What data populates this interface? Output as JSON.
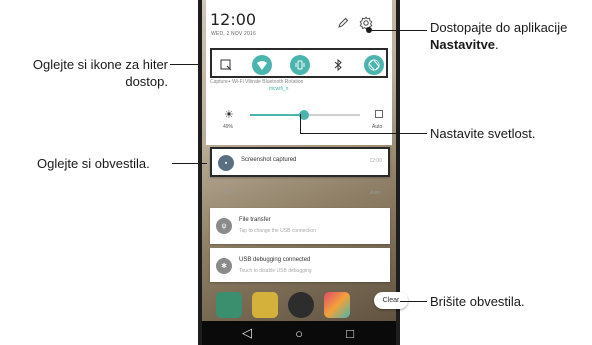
{
  "status": {
    "time": "12:00",
    "date": "WED, 2 NOV 2016"
  },
  "quick_settings": {
    "labels": "Capture+    Wi-Fi      Vibrate   Bluetooth   Rotation",
    "wifi_ssid": "mcwifi_n"
  },
  "brightness": {
    "level_percent": 49,
    "percent_label": "49%",
    "auto_label": "Auto"
  },
  "notifications": [
    {
      "title": "Screenshot captured",
      "subtitle": "",
      "time": "12:00"
    },
    {
      "title": "File transfer",
      "subtitle": "Tap to change the USB connection",
      "time": ""
    },
    {
      "title": "USB debugging connected",
      "subtitle": "Touch to disable USB debugging",
      "time": ""
    }
  ],
  "ghost_row": {
    "pct": "49%",
    "auto": "Auto"
  },
  "clear_button": "Clear",
  "callouts": {
    "settings_line1": "Dostopajte do aplikacije",
    "settings_line2": "Nastavitve",
    "settings_period": ".",
    "quick_line1": "Oglejte si ikone za hiter",
    "quick_line2": "dostop.",
    "brightness": "Nastavite svetlost.",
    "notifications": "Oglejte si obvestila.",
    "clear": "Brišite obvestila."
  },
  "colors": {
    "accent_teal": "#4ab5ad",
    "callout_line": "#1a1a1a"
  },
  "icons": [
    "edit-icon",
    "settings-gear-icon",
    "screen-capture-icon",
    "wifi-icon",
    "vibrate-icon",
    "bluetooth-icon",
    "rotation-icon",
    "brightness-icon",
    "back-icon",
    "home-icon",
    "recents-icon"
  ]
}
